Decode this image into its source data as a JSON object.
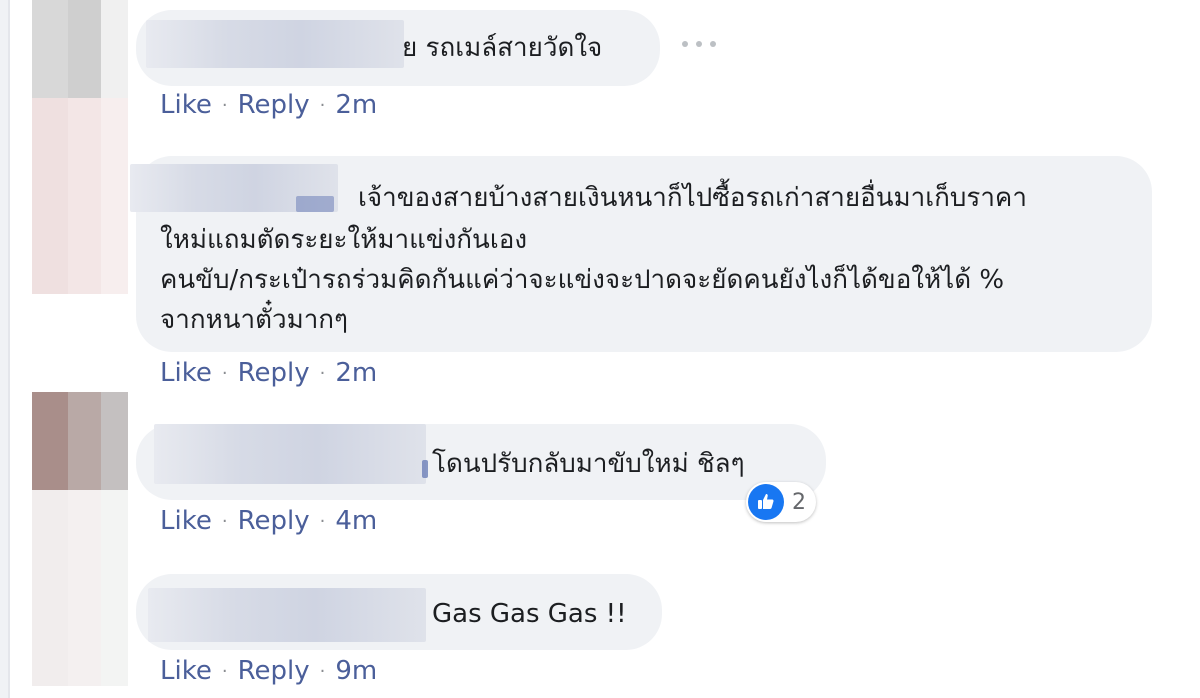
{
  "comments": [
    {
      "text": "ย  รถเมล์สายวัดใจ",
      "actions": {
        "like": "Like",
        "reply": "Reply",
        "time": "2m"
      }
    },
    {
      "text": "ย  เจ้าของสายบ้างสายเงินหนาก็ไปซื้อรถเก่าสายอื่นมาเก็บราคาใหม่แถมตัดระยะให้มาแข่งกันเอง",
      "lines": [
        "เจ้าของสายบ้างสายเงินหนาก็ไปซื้อรถเก่าสายอื่นมาเก็บราคา",
        "ใหม่แถมตัดระยะให้มาแข่งกันเอง",
        "คนขับ/กระเป๋ารถร่วมคิดกันแค่ว่าจะแข่งจะปาดจะยัดคนยังไงก็ได้ขอให้ได้ %",
        "จากหนาตั๋วมากๆ"
      ],
      "actions": {
        "like": "Like",
        "reply": "Reply",
        "time": "2m"
      }
    },
    {
      "text": "โดนปรับกลับมาขับใหม่ ชิลๆ",
      "reaction": {
        "icon": "thumbs-up-icon",
        "count": "2",
        "color": "#1877f2"
      },
      "actions": {
        "like": "Like",
        "reply": "Reply",
        "time": "4m"
      }
    },
    {
      "text": "Gas Gas Gas !!",
      "actions": {
        "like": "Like",
        "reply": "Reply",
        "time": "9m"
      }
    }
  ],
  "separator": "·",
  "colors": {
    "bubble": "#f0f2f5",
    "link": "#4b5f9a",
    "like_blue": "#1877f2"
  }
}
